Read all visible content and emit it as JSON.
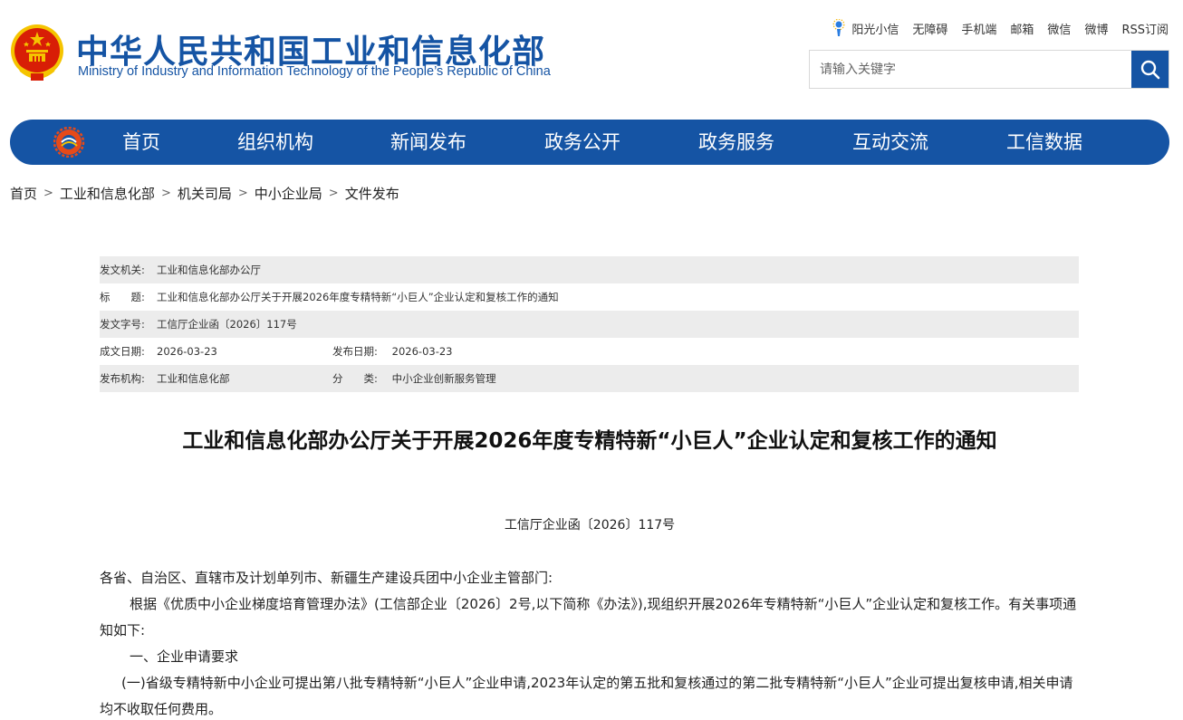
{
  "site": {
    "title": "中华人民共和国工业和信息化部",
    "subtitle": "Ministry of Industry and Information Technology of the People’s Republic of China"
  },
  "toplinks": [
    "阳光小信",
    "无障碍",
    "手机端",
    "邮箱",
    "微信",
    "微博",
    "RSS订阅"
  ],
  "search": {
    "placeholder": "请输入关键字"
  },
  "nav": [
    "首页",
    "组织机构",
    "新闻发布",
    "政务公开",
    "政务服务",
    "互动交流",
    "工信数据"
  ],
  "breadcrumb": [
    "首页",
    "工业和信息化部",
    "机关司局",
    "中小企业局",
    "文件发布"
  ],
  "info": {
    "issuer_label": "发文机关:",
    "issuer": "工业和信息化部办公厅",
    "title_label": "标　　题:",
    "title": "工业和信息化部办公厅关于开展2026年度专精特新“小巨人”企业认定和复核工作的通知",
    "docno_label": "发文字号:",
    "docno": "工信厅企业函〔2026〕117号",
    "created_label": "成文日期:",
    "created": "2026-03-23",
    "published_label": "发布日期:",
    "published": "2026-03-23",
    "org_label": "发布机构:",
    "org": "工业和信息化部",
    "category_label": "分　　类:",
    "category": "中小企业创新服务管理"
  },
  "article": {
    "title": "工业和信息化部办公厅关于开展2026年度专精特新“小巨人”企业认定和复核工作的通知",
    "number": "工信厅企业函〔2026〕117号",
    "salutation": "各省、自治区、直辖市及计划单列市、新疆生产建设兵团中小企业主管部门:",
    "para1": "根据《优质中小企业梯度培育管理办法》(工信部企业〔2026〕2号,以下简称《办法》),现组织开展2026年专精特新“小巨人”企业认定和复核工作。有关事项通知如下:",
    "section1": "一、企业申请要求",
    "para2": "(一)省级专精特新中小企业可提出第八批专精特新“小巨人”企业申请,2023年认定的第五批和复核通过的第二批专精特新“小巨人”企业可提出复核申请,相关申请均不收取任何费用。"
  },
  "colors": {
    "brand_blue": "#1554a4",
    "info_row_shade": "#ececec",
    "emblem_red": "#d81e06",
    "emblem_gold": "#f5c400"
  },
  "icons": {
    "emblem": "national-emblem-icon",
    "sun": "sunshine-icon",
    "search": "search-icon",
    "nav_logo": "miit-logo-icon"
  }
}
